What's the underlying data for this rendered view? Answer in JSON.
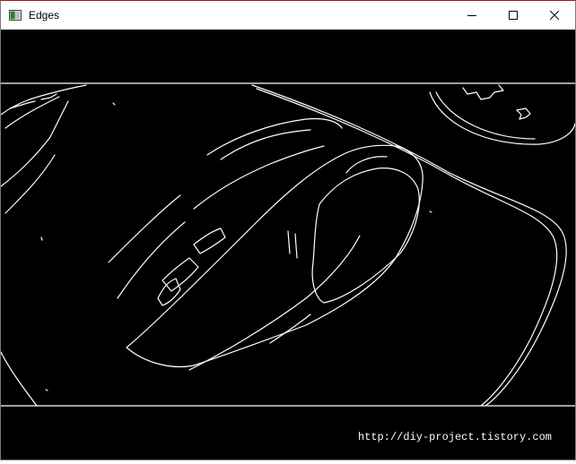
{
  "window": {
    "title": "Edges",
    "controls": {
      "minimize": "minimize",
      "maximize": "maximize",
      "close": "close"
    }
  },
  "image": {
    "description_icon": "edge-detection-output",
    "watermark": "http://diy-project.tistory.com"
  },
  "colors": {
    "background": "#000000",
    "edges": "#ffffff",
    "titlebar": "#ffffff"
  }
}
